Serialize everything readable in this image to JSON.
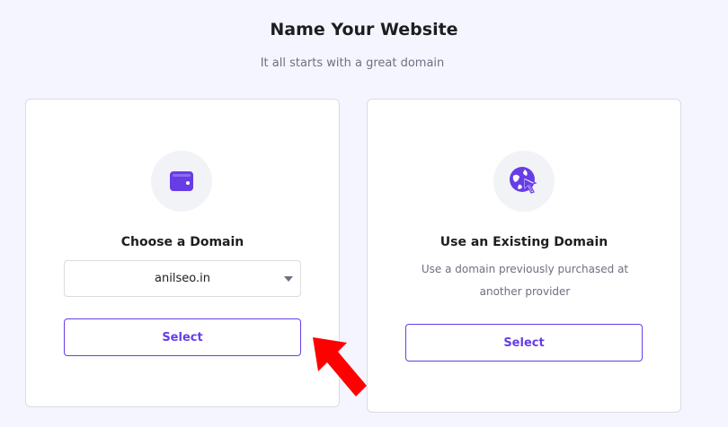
{
  "header": {
    "title": "Name Your Website",
    "subtitle": "It all starts with a great domain"
  },
  "cards": {
    "choose": {
      "icon": "wallet-icon",
      "title": "Choose a Domain",
      "select_value": "anilseo.in",
      "button_label": "Select"
    },
    "existing": {
      "icon": "globe-cursor-icon",
      "title": "Use an Existing Domain",
      "description_line1": "Use a domain previously purchased at",
      "description_line2": "another provider",
      "button_label": "Select"
    }
  },
  "annotation": {
    "icon": "red-arrow-icon",
    "color": "#ff0000"
  },
  "colors": {
    "accent": "#673de6",
    "background": "#f4f5ff"
  }
}
